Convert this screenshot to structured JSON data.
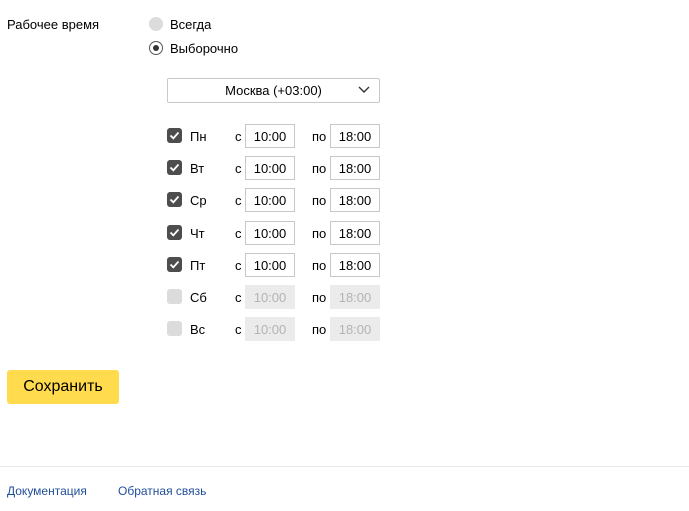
{
  "section": {
    "label": "Рабочее время"
  },
  "mode": {
    "options": [
      {
        "label": "Всегда",
        "selected": false
      },
      {
        "label": "Выборочно",
        "selected": true
      }
    ]
  },
  "timezone": {
    "value": "Москва (+03:00)"
  },
  "labels": {
    "from": "с",
    "to": "по"
  },
  "days": [
    {
      "name": "Пн",
      "enabled": true,
      "from": "10:00",
      "to": "18:00"
    },
    {
      "name": "Вт",
      "enabled": true,
      "from": "10:00",
      "to": "18:00"
    },
    {
      "name": "Ср",
      "enabled": true,
      "from": "10:00",
      "to": "18:00"
    },
    {
      "name": "Чт",
      "enabled": true,
      "from": "10:00",
      "to": "18:00"
    },
    {
      "name": "Пт",
      "enabled": true,
      "from": "10:00",
      "to": "18:00"
    },
    {
      "name": "Сб",
      "enabled": false,
      "from": "10:00",
      "to": "18:00"
    },
    {
      "name": "Вс",
      "enabled": false,
      "from": "10:00",
      "to": "18:00"
    }
  ],
  "actions": {
    "save_label": "Сохранить"
  },
  "footer": {
    "docs_label": "Документация",
    "feedback_label": "Обратная связь"
  },
  "colors": {
    "accent": "#ffdb4d",
    "link": "#1f4e9a",
    "checked": "#4d4d4d",
    "disabled": "#dcdcdc"
  }
}
